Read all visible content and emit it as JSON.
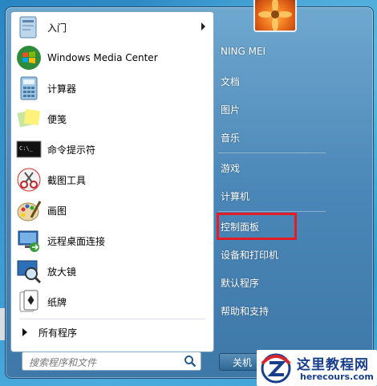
{
  "programs": [
    {
      "label": "入门",
      "icon": "getting-started-icon",
      "has_submenu": true
    },
    {
      "label": "Windows Media Center",
      "icon": "windows-media-center-icon",
      "has_submenu": false
    },
    {
      "label": "计算器",
      "icon": "calculator-icon",
      "has_submenu": false
    },
    {
      "label": "便笺",
      "icon": "sticky-notes-icon",
      "has_submenu": false
    },
    {
      "label": "命令提示符",
      "icon": "command-prompt-icon",
      "has_submenu": false
    },
    {
      "label": "截图工具",
      "icon": "snipping-tool-icon",
      "has_submenu": false
    },
    {
      "label": "画图",
      "icon": "paint-icon",
      "has_submenu": false
    },
    {
      "label": "远程桌面连接",
      "icon": "remote-desktop-icon",
      "has_submenu": false
    },
    {
      "label": "放大镜",
      "icon": "magnifier-icon",
      "has_submenu": false
    },
    {
      "label": "纸牌",
      "icon": "solitaire-icon",
      "has_submenu": false
    }
  ],
  "all_programs_label": "所有程序",
  "search": {
    "placeholder": "搜索程序和文件"
  },
  "right_panel": {
    "user_name": "NING MEI",
    "items": [
      "文档",
      "图片",
      "音乐",
      "游戏",
      "计算机",
      "控制面板",
      "设备和打印机",
      "默认程序",
      "帮助和支持"
    ],
    "highlighted_item": "控制面板"
  },
  "shutdown_label": "关机",
  "watermark": {
    "title": "这里教程网",
    "url": "herecours.com"
  },
  "colors": {
    "highlight": "#e51b25",
    "menu_frame": "#4a86b7",
    "watermark_text": "#1a3f8a"
  }
}
